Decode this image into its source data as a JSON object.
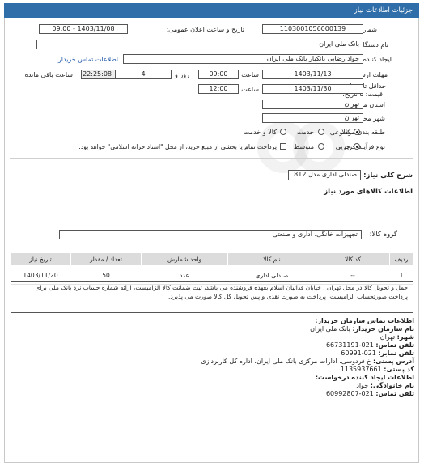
{
  "page_title": "جزئیات اطلاعات نیاز",
  "fields": {
    "need_number_label": "شماره نیاز:",
    "need_number": "1103001056000139",
    "announce_label": "تاریخ و ساعت اعلان عمومی:",
    "announce_value": "1403/11/08 - 09:00",
    "buyer_org_label": "نام دستگاه خریدار:",
    "buyer_org": "بانک ملی ایران",
    "creator_label": "ایجاد کننده درخواست:",
    "creator": "جواد رضایی بانکیار بانک ملی ایران",
    "buyer_contact_link": "اطلاعات تماس خریدار",
    "reply_deadline_label": "مهلت ارسال پاسخ: تا",
    "reply_date": "1403/11/13",
    "time_word": "ساعت",
    "reply_time": "09:00",
    "days_count": "4",
    "days_and": "روز و",
    "remaining_time": "22:25:08",
    "remaining_label": "ساعت باقی مانده",
    "validity_label_1": "حداقل تاریخ اعتبار",
    "validity_label_2": "قیمت: تا تاریخ:",
    "validity_date": "1403/11/30",
    "validity_time": "12:00",
    "province_label": "استان محل تحویل:",
    "province": "تهران",
    "city_label": "شهر محل تحویل:",
    "city": "تهران",
    "category_label": "طبقه بندی موضوعی:",
    "category_options": [
      "کالا",
      "خدمت",
      "کالا و خدمت"
    ],
    "category_selected": "کالا",
    "process_label": "نوع فرآیند خرید :",
    "process_options": [
      "جزیی",
      "متوسط"
    ],
    "process_selected": "جزیی",
    "payment_note": "پرداخت تمام یا بخشی از مبلغ خرید، از محل \"اسناد خزانه اسلامی\" خواهد بود."
  },
  "summary": {
    "label": "شرح کلی نیاز:",
    "value": "صندلی اداری مدل 812"
  },
  "goods_info_title": "اطلاعات کالاهای مورد نیاز",
  "goods_group": {
    "label": "گروه کالا:",
    "value": "تجهیزات خانگی، اداری و صنعتی"
  },
  "table": {
    "headers": [
      "ردیف",
      "کد کالا",
      "نام کالا",
      "واحد شمارش",
      "تعداد / مقدار",
      "تاریخ نیاز"
    ],
    "rows": [
      [
        "1",
        "--",
        "صندلی اداری",
        "عدد",
        "50",
        "1403/11/20"
      ]
    ]
  },
  "description": "حمل و تحویل کالا در محل تهران ، خیابان فدائیان اسلام بعهده فروشنده می باشد، ثبت ضمانت کالا الزامیست، ارائه شماره حساب نزد بانک ملی برای پرداخت صورتحساب الزامیست، پرداخت به صورت نقدی و پس تحویل کل کالا صورت می پذیرد.",
  "contact": {
    "title": "اطلاعات تماس سازمان خریدار:",
    "org_label": "نام سازمان خریدار:",
    "org": "بانک ملی ایران",
    "city_label": "شهر:",
    "city": "تهران",
    "phone_label": "تلفن تماس:",
    "phone": "021-66731191",
    "fax_label": "تلفن نمابر:",
    "fax": "021-60991",
    "address_label": "آدرس پستی:",
    "address": "خ فردوسی، ادارات مرکزی بانک ملی ایران، اداره کل کاربردازی",
    "postal_label": "کد پستی:",
    "postal": "1135937661",
    "creator_title": "اطلاعات ایجاد کننده درخواست:",
    "family_label": "نام خانوادگی:",
    "family": "جواد",
    "creator_phone_label": "تلفن تماس:",
    "creator_phone": "021-60992807"
  }
}
